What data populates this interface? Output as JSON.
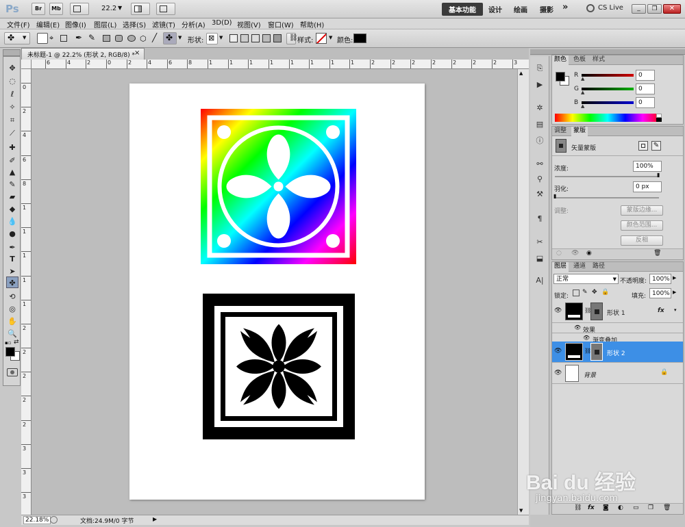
{
  "app": {
    "logo": "Ps",
    "bridge_label": "Br",
    "minibridge_label": "Mb",
    "zoom_value": "22.2",
    "workspaces": [
      "基本功能",
      "设计",
      "绘画",
      "摄影"
    ],
    "more_label": "»",
    "cslive_label": "CS Live"
  },
  "menu": [
    "文件(F)",
    "编辑(E)",
    "图像(I)",
    "图层(L)",
    "选择(S)",
    "滤镜(T)",
    "分析(A)",
    "3D(D)",
    "视图(V)",
    "窗口(W)",
    "帮助(H)"
  ],
  "options": {
    "shape_label": "形状:",
    "style_label": "样式:",
    "color_label": "颜色:",
    "color_value": "#000000"
  },
  "document": {
    "tab_title": "未标题-1 @ 22.2% (形状 2, RGB/8) *",
    "close_icon": "×",
    "hruler_ticks": [
      "6",
      "4",
      "2",
      "0",
      "2",
      "4",
      "6",
      "8",
      "1",
      "1",
      "1",
      "1",
      "1",
      "1",
      "1",
      "1",
      "2",
      "2",
      "2",
      "2",
      "2",
      "2",
      "2",
      "3"
    ],
    "vruler_ticks": [
      "0",
      "2",
      "4",
      "6",
      "8",
      "1",
      "1",
      "1",
      "1",
      "1",
      "2",
      "2",
      "2",
      "2",
      "2",
      "3",
      "3",
      "3"
    ]
  },
  "status": {
    "zoom": "22.18%",
    "doc_info": "文档:24.9M/0 字节"
  },
  "color_panel": {
    "tabs": [
      "颜色",
      "色板",
      "样式"
    ],
    "channels": [
      {
        "name": "R",
        "value": "0",
        "color": "#d00000"
      },
      {
        "name": "G",
        "value": "0",
        "color": "#00b000"
      },
      {
        "name": "B",
        "value": "0",
        "color": "#0000d0"
      }
    ]
  },
  "masks_panel": {
    "tabs": [
      "调整",
      "蒙版"
    ],
    "mask_type": "矢量蒙版",
    "density_label": "浓度:",
    "density_value": "100%",
    "feather_label": "羽化:",
    "feather_value": "0 px",
    "refine_label": "调整:",
    "buttons": [
      "蒙版边缘...",
      "颜色范围...",
      "反相"
    ]
  },
  "layers_panel": {
    "tabs": [
      "图层",
      "通道",
      "路径"
    ],
    "blend_mode": "正常",
    "opacity_label": "不透明度:",
    "opacity_value": "100%",
    "lock_label": "锁定:",
    "fill_label": "填充:",
    "fill_value": "100%",
    "layers": [
      {
        "name": "形状 1",
        "fx": "fx",
        "effects_label": "效果",
        "effect_name": "渐变叠加"
      },
      {
        "name": "形状 2"
      },
      {
        "name": "背景"
      }
    ]
  },
  "watermark": {
    "brand": "Bai du 经验",
    "url": "jingyan.baidu.com"
  }
}
